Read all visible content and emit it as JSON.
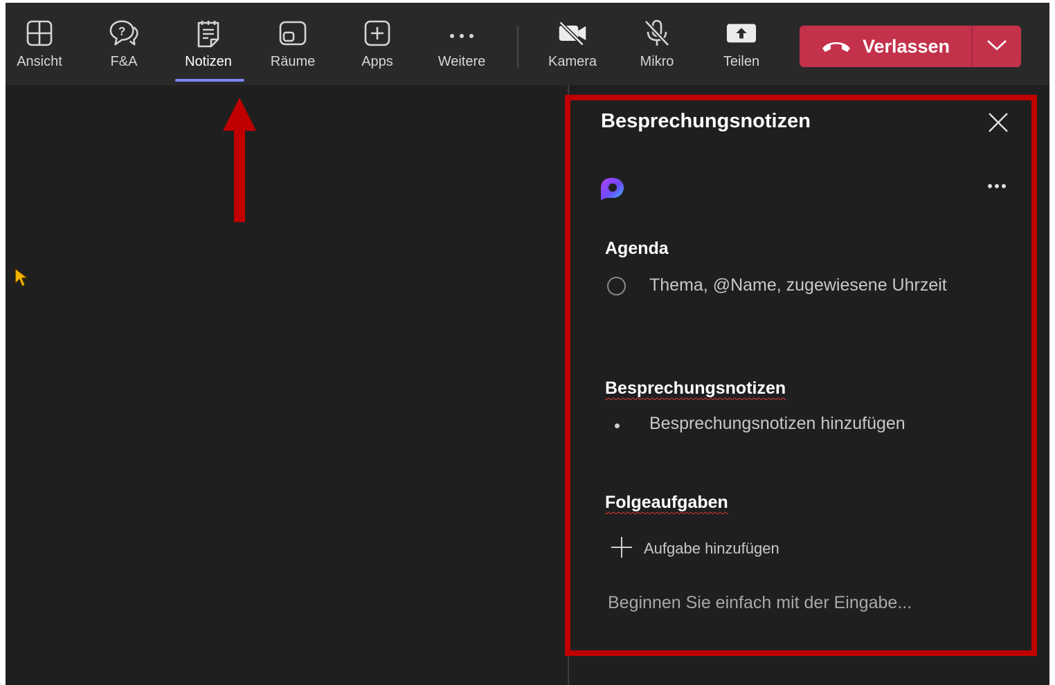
{
  "toolbar": {
    "items": [
      {
        "label": "Ansicht",
        "icon": "layout-grid-icon"
      },
      {
        "label": "F&A",
        "icon": "qna-icon"
      },
      {
        "label": "Notizen",
        "icon": "notes-icon"
      },
      {
        "label": "Räume",
        "icon": "rooms-icon"
      },
      {
        "label": "Apps",
        "icon": "add-app-icon"
      },
      {
        "label": "Weitere",
        "icon": "more-icon"
      },
      {
        "label": "Kamera",
        "icon": "camera-off-icon"
      },
      {
        "label": "Mikro",
        "icon": "mic-off-icon"
      },
      {
        "label": "Teilen",
        "icon": "share-icon"
      }
    ],
    "active_item": "Notizen",
    "leave_label": "Verlassen"
  },
  "notes_panel": {
    "title": "Besprechungsnotizen",
    "agenda": {
      "heading": "Agenda",
      "placeholder": "Thema, @Name, zugewiesene Uhrzeit"
    },
    "meeting_notes": {
      "heading": "Besprechungsnotizen",
      "placeholder": "Besprechungsnotizen hinzufügen"
    },
    "follow_up": {
      "heading": "Folgeaufgaben",
      "add_task_label": "Aufgabe hinzufügen"
    },
    "start_typing": "Beginnen Sie einfach mit der Eingabe..."
  },
  "colors": {
    "app_background": "#1f1f1f",
    "toolbar_background": "#292929",
    "leave_button": "#c4314b",
    "active_underline": "#7f85f5",
    "annotation_red": "#c00000"
  }
}
